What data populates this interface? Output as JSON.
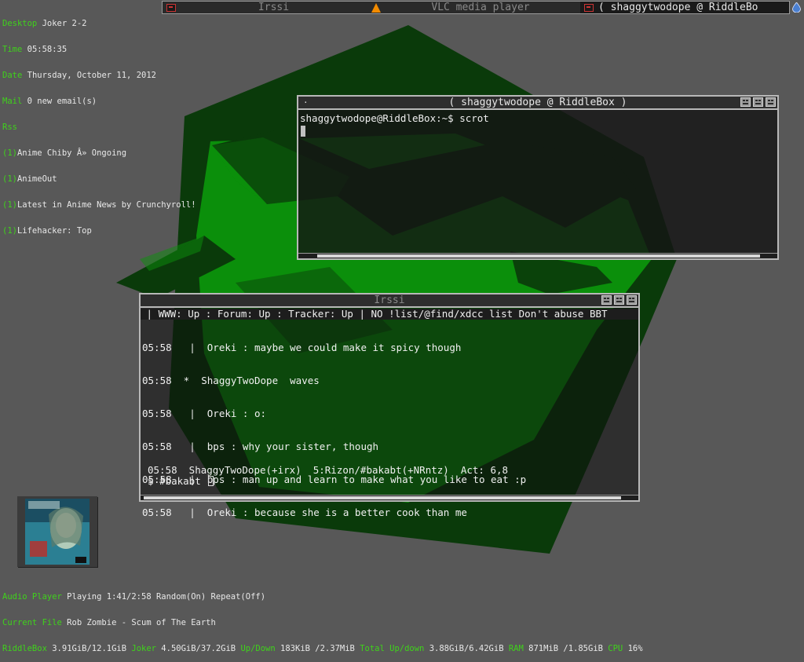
{
  "conky_top": {
    "desktop_label": "Desktop",
    "desktop_value": " Joker 2-2",
    "time_label": "Time",
    "time_value": " 05:58:35",
    "date_label": "Date",
    "date_value": " Thursday, October 11, 2012",
    "mail_label": "Mail",
    "mail_value": " 0 new email(s)",
    "rss_label": "Rss",
    "feeds": [
      {
        "count": "(1)",
        "title": "Anime Chiby Â» Ongoing"
      },
      {
        "count": "(1)",
        "title": "AnimeOut"
      },
      {
        "count": "(1)",
        "title": "Latest in Anime News by Crunchyroll!"
      },
      {
        "count": "(1)",
        "title": "Lifehacker: Top"
      }
    ]
  },
  "taskbar": {
    "tasks": [
      {
        "label": "Irssi"
      },
      {
        "label": "VLC media player"
      },
      {
        "label": "( shaggytwodope @ RiddleBo"
      }
    ]
  },
  "terminal": {
    "title": "( shaggytwodope @ RiddleBox )",
    "title_dot": "·",
    "prompt_line": "shaggytwodope@RiddleBox:~$ scrot"
  },
  "irssi": {
    "title": "Irssi",
    "topic": " | WWW: Up : Forum: Up : Tracker: Up | NO !list/@find/xdcc list Don't abuse BBT",
    "messages": [
      "05:58   |  Oreki : maybe we could make it spicy though",
      "05:58  *  ShaggyTwoDope  waves",
      "05:58   |  Oreki : o:",
      "05:58   |  bps : why your sister, though",
      "05:58   |  bps : man up and learn to make what you like to eat :p",
      "05:58   |  Oreki : because she is a better cook than me"
    ],
    "status_line": "05:58  ShaggyTwoDope(+irx)  5:Rizon/#bakabt(+NRntz)  Act: 6,8",
    "input_prompt": "$ #bakabt "
  },
  "conky_bottom": {
    "audio_label": "Audio Player",
    "audio_value": " Playing 1:41/2:58 Random(On) Repeat(Off)",
    "file_label": "Current File",
    "file_value": " Rob Zombie - Scum of The Earth",
    "riddlebox_label": "RiddleBox",
    "riddlebox_value": " 3.91GiB/12.1GiB ",
    "joker_label": "Joker",
    "joker_value": " 4.50GiB/37.2GiB ",
    "updown_label": "Up/Down",
    "updown_value": " 183KiB /2.37MiB ",
    "total_label": "Total Up/down",
    "total_value": " 3.88GiB/6.42GiB ",
    "ram_label": "RAM",
    "ram_value": " 871MiB /1.85GiB ",
    "cpu_label": "CPU",
    "cpu_value": " 16%"
  },
  "colors": {
    "background": "#585858",
    "conky_label": "#3fd21b",
    "wallpaper_green": "#0b8f0b",
    "wallpaper_dark": "#0a3a0a"
  },
  "icons": [
    "terminal-icon",
    "vlc-cone-icon",
    "droplet-icon",
    "window-buttons-icon"
  ]
}
